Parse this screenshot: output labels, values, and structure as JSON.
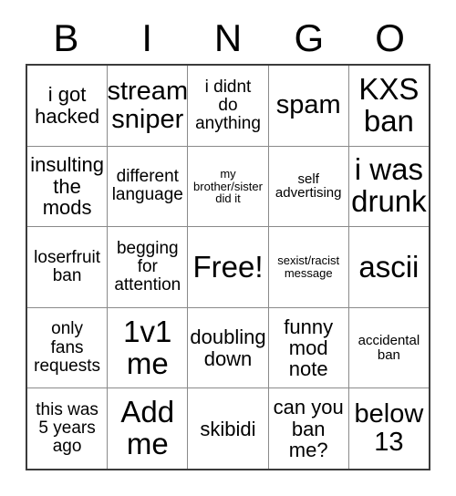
{
  "card": {
    "headers": [
      "B",
      "I",
      "N",
      "G",
      "O"
    ],
    "free_space_text": "Free!",
    "colors": {
      "background": "#ffffff",
      "text": "#000000",
      "grid_line": "#8a8a8a",
      "outer_border": "#3b3b3b"
    },
    "rows": [
      [
        {
          "text": "i got\nhacked",
          "size": "md"
        },
        {
          "text": "stream\nsniper",
          "size": "lg"
        },
        {
          "text": "i didnt\ndo\nanything",
          "size": "sm"
        },
        {
          "text": "spam",
          "size": "lg"
        },
        {
          "text": "KXS\nban",
          "size": "xl"
        }
      ],
      [
        {
          "text": "insulting\nthe\nmods",
          "size": "md"
        },
        {
          "text": "different\nlanguage",
          "size": "sm"
        },
        {
          "text": "my\nbrother/sister\ndid it",
          "size": "xxs"
        },
        {
          "text": "self\nadvertising",
          "size": "xs"
        },
        {
          "text": "i was\ndrunk",
          "size": "xl"
        }
      ],
      [
        {
          "text": "loserfruit\nban",
          "size": "sm"
        },
        {
          "text": "begging\nfor\nattention",
          "size": "sm"
        },
        {
          "text": "Free!",
          "size": "xl"
        },
        {
          "text": "sexist/racist\nmessage",
          "size": "xxs"
        },
        {
          "text": "ascii",
          "size": "xl"
        }
      ],
      [
        {
          "text": "only\nfans\nrequests",
          "size": "sm"
        },
        {
          "text": "1v1\nme",
          "size": "xl"
        },
        {
          "text": "doubling\ndown",
          "size": "md"
        },
        {
          "text": "funny\nmod\nnote",
          "size": "md"
        },
        {
          "text": "accidental\nban",
          "size": "xs"
        }
      ],
      [
        {
          "text": "this was\n5 years\nago",
          "size": "sm"
        },
        {
          "text": "Add\nme",
          "size": "xl"
        },
        {
          "text": "skibidi",
          "size": "md"
        },
        {
          "text": "can you\nban\nme?",
          "size": "md"
        },
        {
          "text": "below\n13",
          "size": "lg"
        }
      ]
    ]
  }
}
